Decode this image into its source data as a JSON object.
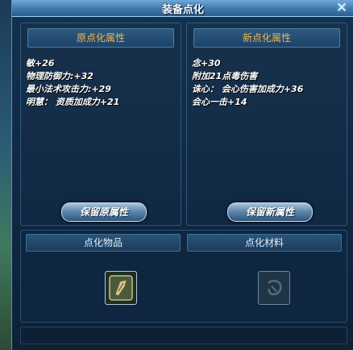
{
  "window": {
    "title": "装备点化",
    "close_glyph": "✕"
  },
  "left_panel": {
    "header": "原点化属性",
    "attributes": [
      "敏+26",
      "物理防御力:+32",
      "最小法术攻击力:+29",
      "明慧： 资质加成力+21"
    ],
    "keep_button": "保留原属性"
  },
  "right_panel": {
    "header": "新点化属性",
    "attributes": [
      "念+30",
      "附加21点毒伤害",
      "诛心： 会心伤害加成力+36",
      "会心一击+14"
    ],
    "keep_button": "保留新属性"
  },
  "bottom": {
    "item_header": "点化物品",
    "material_header": "点化材料",
    "item_slot_icon": "equipment-item-icon",
    "material_slot_icon": "empty-material-icon"
  },
  "colors": {
    "header_gold": "#f0b84a",
    "title_bar": "#3e79ad",
    "panel_bg": "#112843"
  }
}
